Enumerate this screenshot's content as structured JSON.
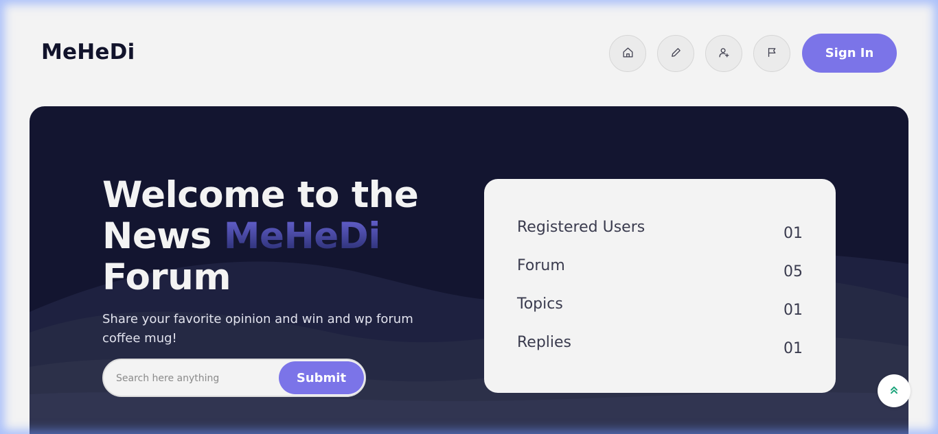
{
  "brand": {
    "logo_text": "MeHeDi"
  },
  "nav": {
    "icons": [
      "home-icon",
      "pencil-icon",
      "user-plus-icon",
      "flag-icon"
    ],
    "sign_in_label": "Sign In"
  },
  "hero": {
    "title_line1": "Welcome to the",
    "title_line2_plain": "News ",
    "title_line2_accent": "MeHeDi",
    "title_line3": "Forum",
    "subtitle": "Share your favorite opinion and win and wp forum coffee mug!",
    "search_placeholder": "Search here anything",
    "submit_label": "Submit"
  },
  "stats": [
    {
      "label": "Registered Users",
      "value": "01"
    },
    {
      "label": "Forum",
      "value": "05"
    },
    {
      "label": "Topics",
      "value": "01"
    },
    {
      "label": "Replies",
      "value": "01"
    }
  ],
  "colors": {
    "accent": "#7b74e8",
    "hero_bg": "#131530",
    "page_bg": "#f3f3f3",
    "back_to_top_icon": "#1aa37a"
  },
  "back_to_top_icon": "double-chevron-up-icon"
}
